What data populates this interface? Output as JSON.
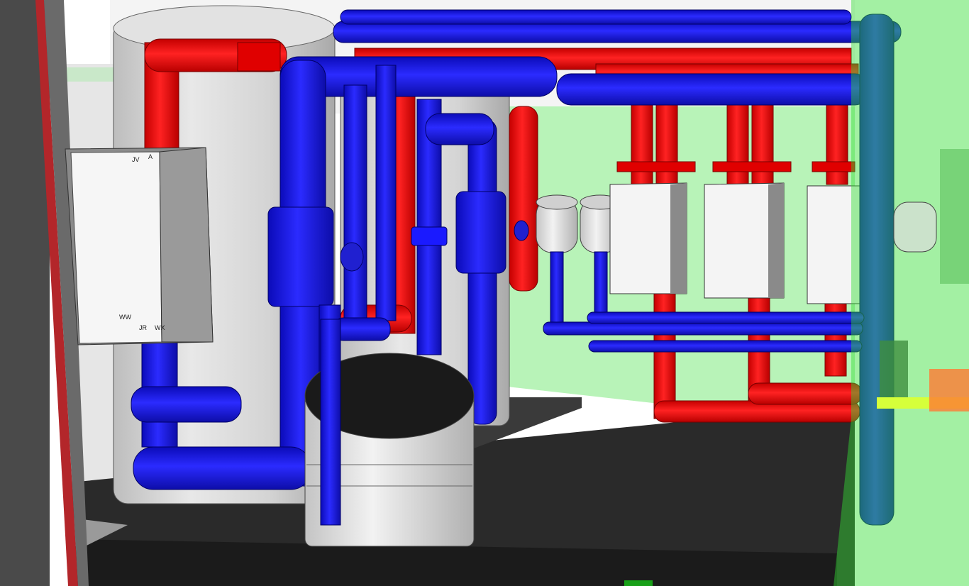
{
  "scene": {
    "description_labels": {
      "panel_top_left": "JV",
      "panel_top_right": "A",
      "panel_bottom_left": "WW",
      "panel_bottom_mid": "JR",
      "panel_bottom_right": "WX"
    },
    "colors": {
      "hot_pipe": "#ff1a1a",
      "cold_pipe": "#1a1aff",
      "tank": "#d8d8d8",
      "floor": "#262626",
      "wall_green": "#b6f2b6",
      "green_overlay": "#33cc33",
      "frame_red": "#b3262a"
    },
    "components": {
      "large_tanks": 2,
      "small_expansion_tank": 1,
      "boilers": 3,
      "expansion_vessels": 3,
      "control_panel": 1
    }
  }
}
